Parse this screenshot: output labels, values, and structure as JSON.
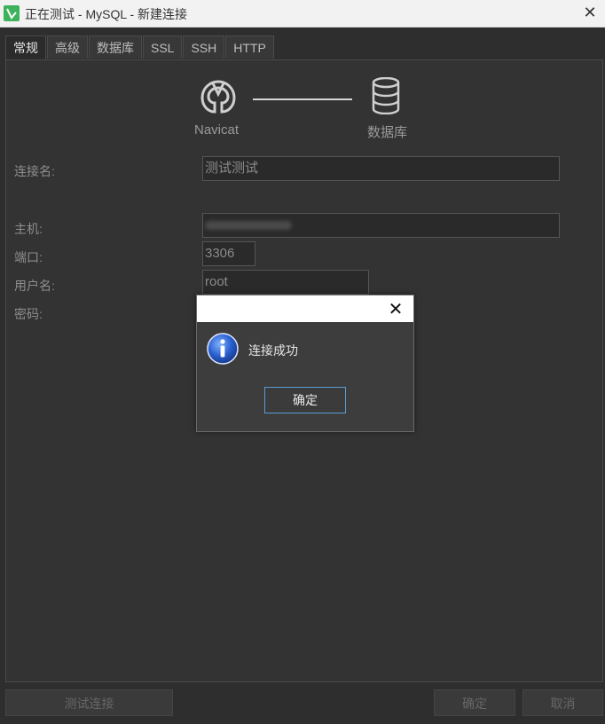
{
  "window": {
    "title": "正在测试 - MySQL - 新建连接"
  },
  "tabs": [
    {
      "label": "常规",
      "active": true
    },
    {
      "label": "高级"
    },
    {
      "label": "数据库"
    },
    {
      "label": "SSL"
    },
    {
      "label": "SSH"
    },
    {
      "label": "HTTP"
    }
  ],
  "graphic": {
    "left_caption": "Navicat",
    "right_caption": "数据库"
  },
  "form": {
    "connection_name_label": "连接名:",
    "connection_name_value": "测试测试",
    "host_label": "主机:",
    "port_label": "端口:",
    "port_value": "3306",
    "user_label": "用户名:",
    "user_value": "root",
    "password_label": "密码:"
  },
  "buttons": {
    "test_connection": "测试连接",
    "ok": "确定",
    "cancel": "取消"
  },
  "dialog": {
    "message": "连接成功",
    "ok": "确定",
    "icon": "info-icon"
  },
  "colors": {
    "accent_border": "#5b9bd5",
    "app_icon": "#3cb35a"
  }
}
